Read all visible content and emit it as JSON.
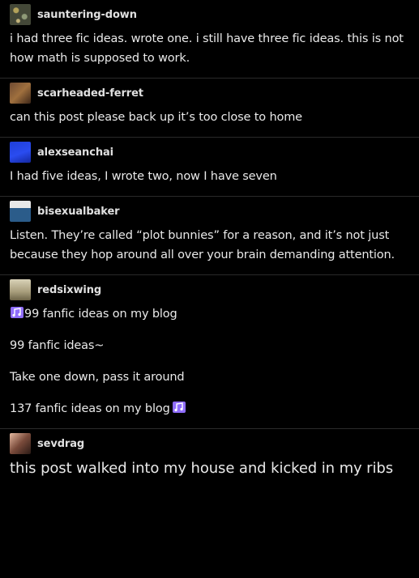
{
  "posts": [
    {
      "username": "sauntering-down",
      "avatar": "avatar-sparkles",
      "paragraphs": [
        "i had three fic ideas.  wrote one.  i still have three fic ideas.  this is not how math is supposed to work."
      ]
    },
    {
      "username": "scarheaded-ferret",
      "avatar": "avatar-ferret",
      "paragraphs": [
        "can this post please back up it’s too close to home"
      ]
    },
    {
      "username": "alexseanchai",
      "avatar": "avatar-blue",
      "paragraphs": [
        "I had five ideas, I wrote two, now I have seven"
      ]
    },
    {
      "username": "bisexualbaker",
      "avatar": "avatar-teapot",
      "paragraphs": [
        "Listen. They’re called “plot bunnies” for a reason, and it’s not just because they hop around all over your brain demanding attention."
      ]
    },
    {
      "username": "redsixwing",
      "avatar": "avatar-statue",
      "lines": {
        "line1": "99 fanfic ideas on my blog",
        "line2": "99 fanfic ideas~",
        "line3": "Take one down, pass it around",
        "line4": "137 fanfic ideas on my blog"
      },
      "icon": "musical-notes-icon",
      "icon_color": "#8f6dfc"
    },
    {
      "username": "sevdrag",
      "avatar": "avatar-face",
      "paragraphs": [
        "this post walked into my house and kicked in my ribs"
      ]
    }
  ],
  "colors": {
    "background": "#000000",
    "text": "#e9e9e9",
    "divider": "#2a2a2a",
    "accent": "#8f6dfc"
  }
}
